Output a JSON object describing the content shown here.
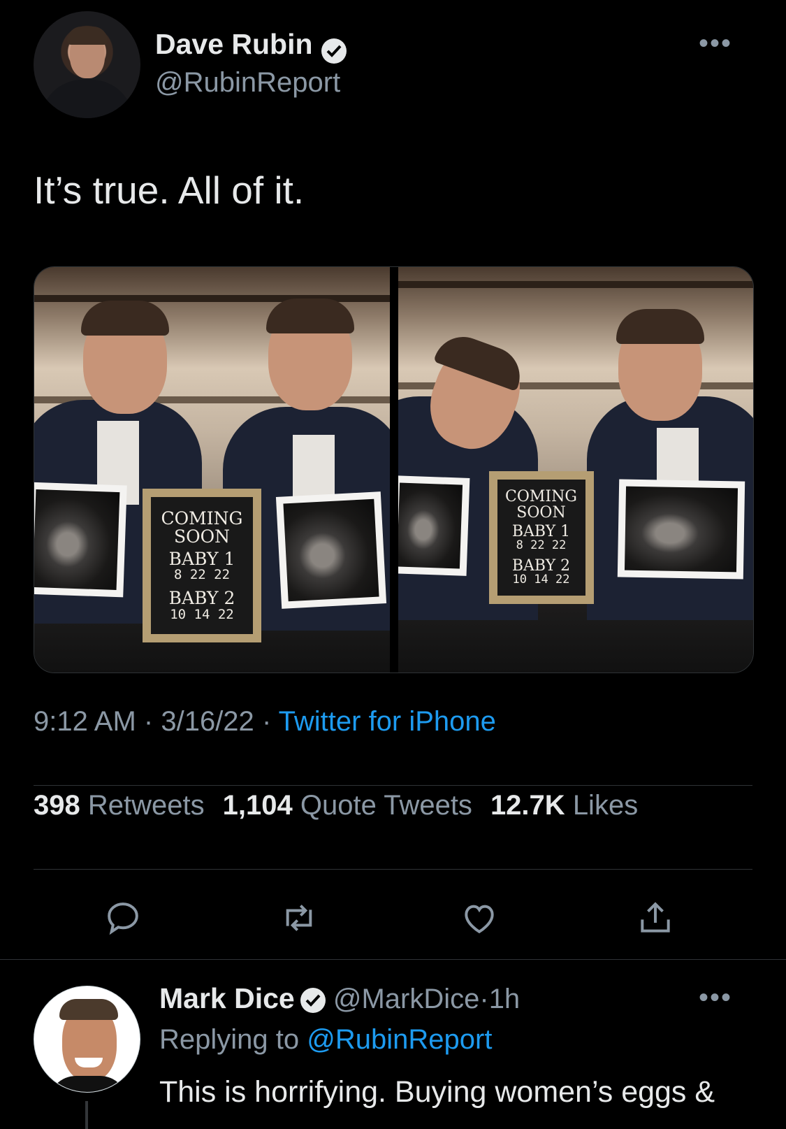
{
  "tweet": {
    "author_name": "Dave Rubin",
    "author_handle": "@RubinReport",
    "more_label": "•••",
    "text": "It’s true. All of it.",
    "time": "9:12 AM",
    "date": "3/16/22",
    "separator": "·",
    "source": "Twitter for iPhone",
    "media": [
      {
        "board_line1": "COMING",
        "board_line2": "SOON",
        "board_line3": "BABY 1",
        "board_line4": "8 22 22",
        "board_line5": "BABY 2",
        "board_line6": "10 14 22"
      },
      {
        "board_line1": "COMING",
        "board_line2": "SOON",
        "board_line3": "BABY 1",
        "board_line4": "8 22 22",
        "board_line5": "BABY 2",
        "board_line6": "10 14 22"
      }
    ],
    "stats": {
      "retweets_count": "398",
      "retweets_label": "Retweets",
      "quotes_count": "1,104",
      "quotes_label": "Quote Tweets",
      "likes_count": "12.7K",
      "likes_label": "Likes"
    },
    "actions": [
      "reply-icon",
      "retweet-icon",
      "like-icon",
      "share-icon"
    ]
  },
  "reply": {
    "author_name": "Mark Dice",
    "author_handle": "@MarkDice",
    "separator": "·",
    "age": "1h",
    "more_label": "•••",
    "replying_prefix": "Replying to",
    "replying_mention": "@RubinReport",
    "text": "This is horrifying.  Buying women’s eggs &"
  },
  "colors": {
    "background": "#000000",
    "text": "#e7e9ea",
    "secondary": "#8b98a5",
    "link": "#1d9bf0",
    "divider": "#2f3336"
  }
}
